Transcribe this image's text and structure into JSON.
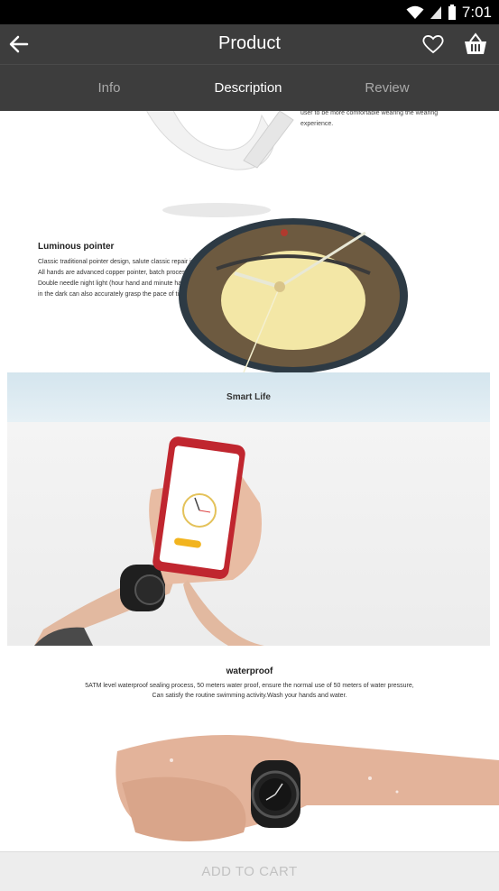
{
  "status_bar": {
    "time": "7:01"
  },
  "app_bar": {
    "title": "Product"
  },
  "tabs": [
    {
      "label": "Info",
      "active": false
    },
    {
      "label": "Description",
      "active": true
    },
    {
      "label": "Review",
      "active": false
    }
  ],
  "description": {
    "strap_text": [
      "user to be more comfortable wearing the wearing",
      "experience."
    ],
    "luminous": {
      "title": "Luminous pointer",
      "lines": [
        "Classic traditional pointer design, salute classic repair inside.",
        "All hands are advanced copper pointer, batch process polishing.",
        "Double needle night light (hour hand and minute hand),",
        "in the dark can also accurately grasp the pace of time."
      ]
    },
    "smart_life": {
      "title": "Smart Life"
    },
    "waterproof": {
      "title": "waterproof",
      "lines": [
        "5ATM level waterproof sealing process, 50 meters water proof, ensure the normal use of 50 meters of water pressure,",
        "Can satisfy the routine swimming activity.Wash your hands and water."
      ]
    }
  },
  "cart": {
    "label": "ADD TO CART"
  }
}
